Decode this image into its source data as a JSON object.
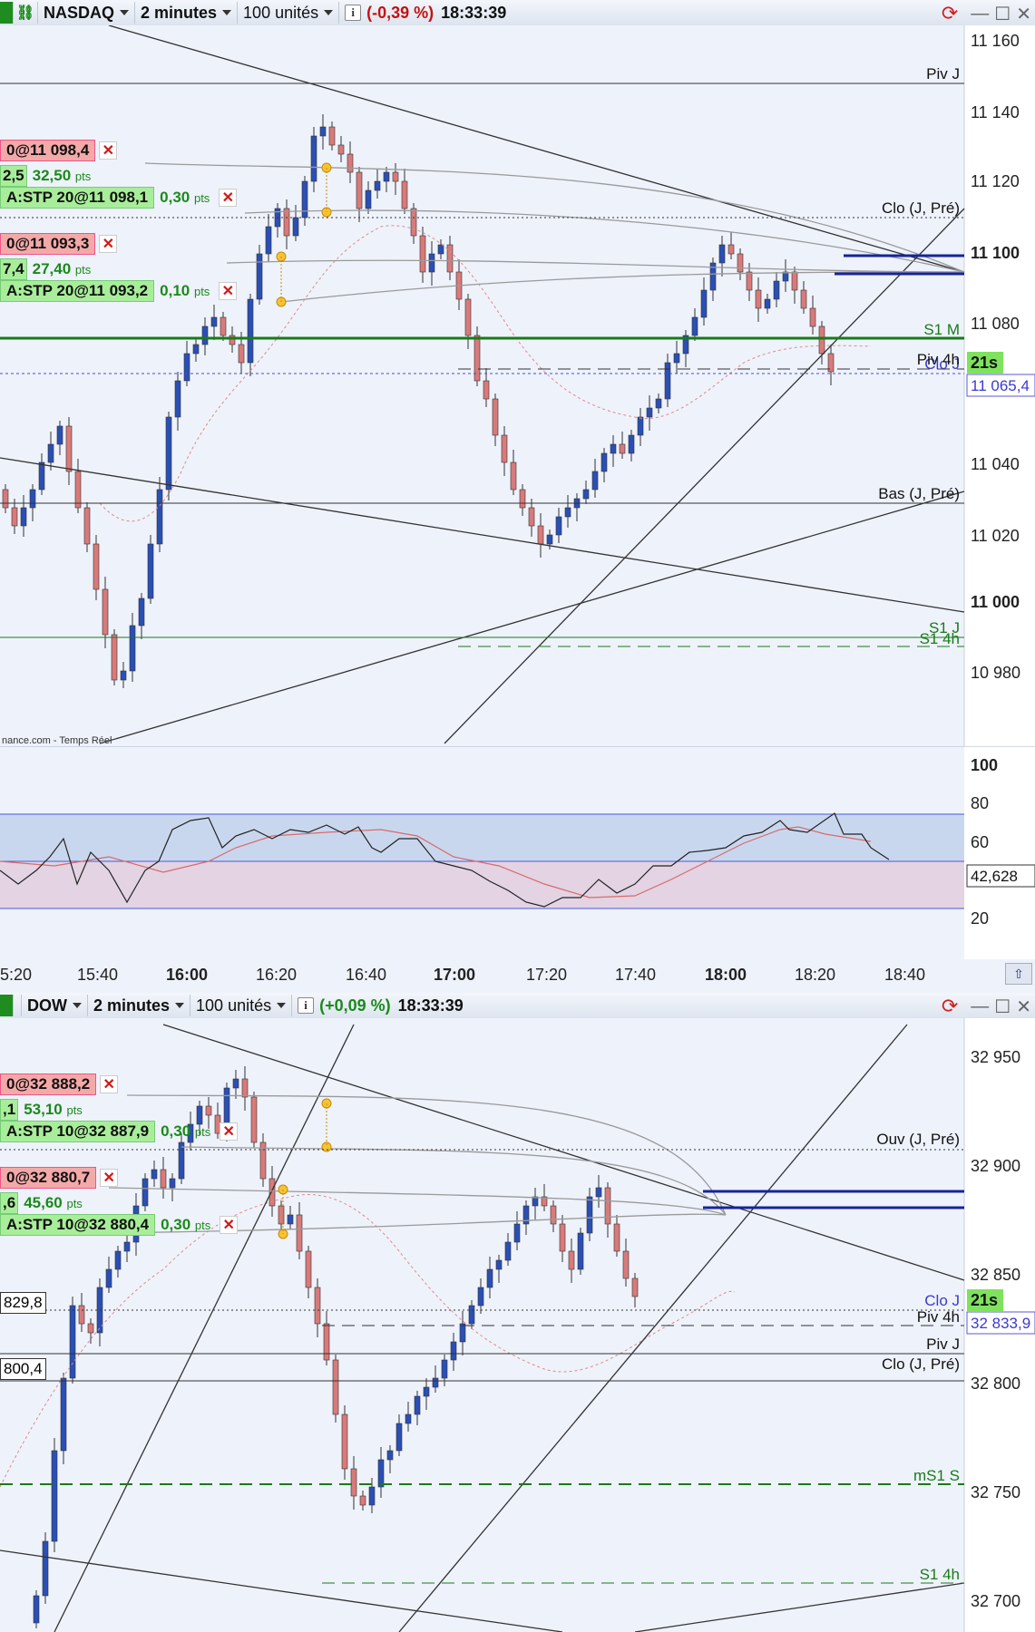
{
  "top": {
    "instrument": "NASDAQ",
    "timeframe": "2 minutes",
    "units": "100 unités",
    "change": "(-0,39 %)",
    "time": "18:33:39",
    "y_ticks": [
      "11 160",
      "11 140",
      "11 120",
      "11 100",
      "11 080",
      "11 040",
      "11 020",
      "11 000",
      "10 980"
    ],
    "level_labels": {
      "piv_j": "Piv J",
      "clo_j_pre": "Clo (J, Pré)",
      "s1_m": "S1 M",
      "piv_4h": "Piv 4h",
      "clo_j": "Clo J",
      "bas_j_pre": "Bas (J, Pré)",
      "s1_j": "S1 J",
      "s1_4h": "S1 4h"
    },
    "last_price": "11 065,4",
    "countdown": "21s",
    "source": "nance.com - Temps Réel",
    "orders": [
      {
        "red": "0@11 098,4",
        "pts_left": "2,5",
        "pts": "32,50",
        "pts_unit": "pts",
        "stop": "A:STP 20@11 098,1",
        "stop_pts": "0,30",
        "stop_unit": "pts"
      },
      {
        "red": "0@11 093,3",
        "pts_left": "7,4",
        "pts": "27,40",
        "pts_unit": "pts",
        "stop": "A:STP 20@11 093,2",
        "stop_pts": "0,10",
        "stop_unit": "pts"
      }
    ],
    "rsi_ticks": [
      "100",
      "80",
      "60",
      "20"
    ],
    "rsi_value": "42,628",
    "x_ticks": [
      "5:20",
      "15:40",
      "16:00",
      "16:20",
      "16:40",
      "17:00",
      "17:20",
      "17:40",
      "18:00",
      "18:20",
      "18:40"
    ]
  },
  "bottom": {
    "instrument": "DOW",
    "timeframe": "2 minutes",
    "units": "100 unités",
    "change": "(+0,09 %)",
    "time": "18:33:39",
    "y_ticks": [
      "32 950",
      "32 900",
      "32 850",
      "32 800",
      "32 750",
      "32 700"
    ],
    "level_labels": {
      "ouv_j_pre": "Ouv (J, Pré)",
      "clo_j": "Clo J",
      "piv_4h": "Piv 4h",
      "piv_j": "Piv J",
      "clo_j_pre": "Clo (J, Pré)",
      "ms1_s": "mS1 S",
      "s1_4h": "S1 4h"
    },
    "last_price": "32 833,9",
    "countdown": "21s",
    "left_prices": [
      "829,8",
      "800,4"
    ],
    "orders": [
      {
        "red": "0@32 888,2",
        "pts_left": ",1",
        "pts": "53,10",
        "pts_unit": "pts",
        "stop": "A:STP 10@32 887,9",
        "stop_pts": "0,30",
        "stop_unit": "pts"
      },
      {
        "red": "0@32 880,7",
        "pts_left": ",6",
        "pts": "45,60",
        "pts_unit": "pts",
        "stop": "A:STP 10@32 880,4",
        "stop_pts": "0,30",
        "stop_unit": "pts"
      }
    ]
  },
  "colors": {
    "bull": "#2a4fb5",
    "bear": "#d97a7a",
    "level_green": "#1a7a1a",
    "order_blue": "#16249a",
    "trend": "#333333"
  }
}
